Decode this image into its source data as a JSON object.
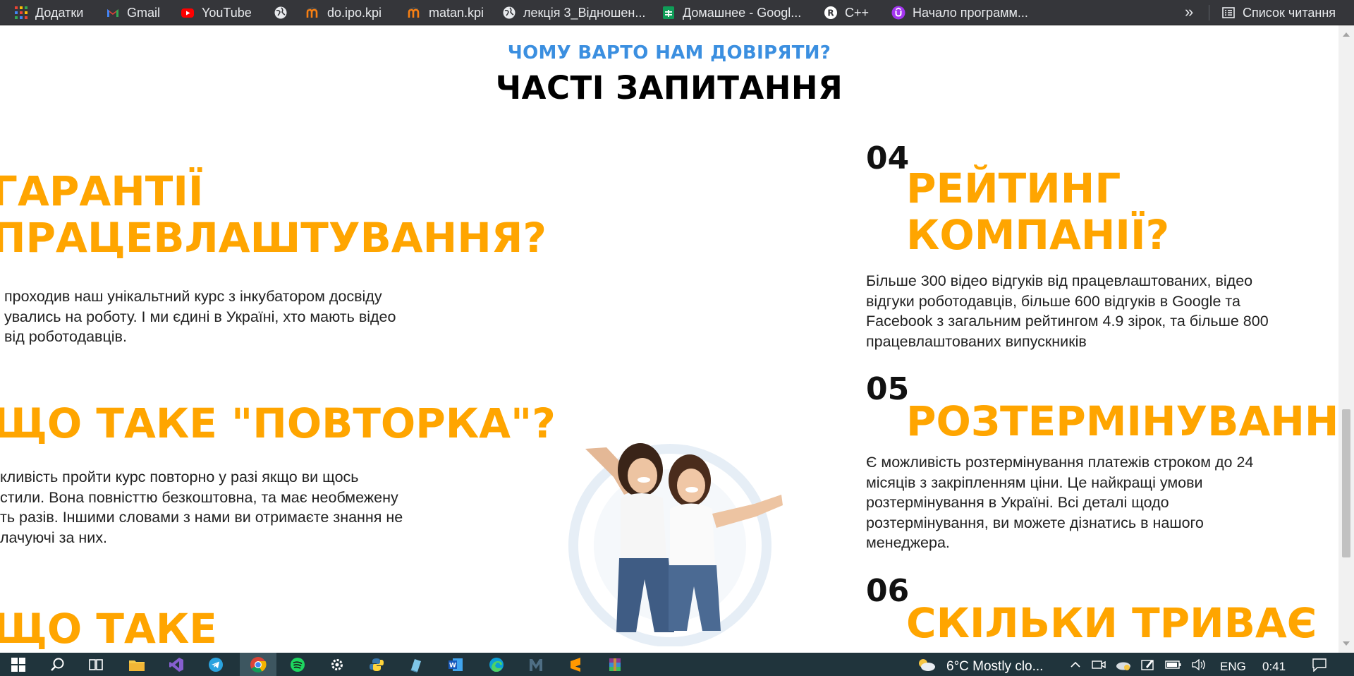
{
  "bookmarks": {
    "items": [
      {
        "label": "Додатки",
        "icon": "apps-grid-icon"
      },
      {
        "label": "Gmail",
        "icon": "gmail-icon"
      },
      {
        "label": "YouTube",
        "icon": "youtube-icon"
      },
      {
        "label": "",
        "icon": "globe-icon"
      },
      {
        "label": "do.ipo.kpi",
        "icon": "moodle-icon"
      },
      {
        "label": "matan.kpi",
        "icon": "moodle-icon"
      },
      {
        "label": "лекція 3_Відношен...",
        "icon": "globe-icon"
      },
      {
        "label": "Домашнее - Googl...",
        "icon": "google-sheets-icon"
      },
      {
        "label": "C++",
        "icon": "replit-icon"
      },
      {
        "label": "Начало программ...",
        "icon": "udemy-icon"
      }
    ],
    "overflow": "»",
    "reading_list": "Список читання"
  },
  "section": {
    "subtitle": "ЧОМУ ВАРТО НАМ ДОВІРЯТИ?",
    "title": "ЧАСТІ ЗАПИТАННЯ"
  },
  "faq_left": [
    {
      "title_lines": [
        "ГАРАНТІЇ",
        "ПРАЦЕВЛАШТУВАННЯ?"
      ],
      "text_lines": [
        "проходив наш унікальтний курс з інкубатором досвіду",
        "увались на роботу. І ми єдині в Україні, хто мають відео",
        "від роботодавців."
      ]
    },
    {
      "title_lines": [
        "ЩО ТАКЕ \"ПОВТОРКА\"?"
      ],
      "text_lines": [
        "кливість пройти курс повторно у разі якщо ви щось",
        "стили. Вона повністтю безкоштовна, та має необмежену",
        "ть разів. Іншими словами з нами ви отримаєте знання не",
        "лачуючі за них."
      ]
    },
    {
      "title_lines": [
        "ЩО ТАКЕ"
      ],
      "text_lines": []
    }
  ],
  "faq_right": [
    {
      "number": "04",
      "title_lines": [
        "РЕЙТИНГ",
        "КОМПАНІЇ?"
      ],
      "text_lines": [
        "Більше 300 відео відгуків від працевлаштованих, відео",
        "відгуки роботодавців, більше 600 відгуків в Google та",
        "Facebook з загальним рейтингом 4.9 зірок, та більше 800",
        "працевлаштованих випускників"
      ]
    },
    {
      "number": "05",
      "title_lines": [
        "РОЗТЕРМІНУВАННЯ?"
      ],
      "text_lines": [
        "Є можливість розтермінування платежів строком до 24",
        "місяців з закріпленням ціни. Це найкращі умови",
        "розтермінування в Україні. Всі деталі щодо",
        "розтермінування, ви можете дізнатись в нашого",
        "менеджера."
      ]
    },
    {
      "number": "06",
      "title_lines": [
        "СКІЛЬКИ ТРИВАЄ"
      ],
      "text_lines": []
    }
  ],
  "illustration": {
    "icon": "two-smiling-women-image"
  },
  "taskbar": {
    "apps": [
      {
        "icon": "windows-start-icon"
      },
      {
        "icon": "search-icon"
      },
      {
        "icon": "task-view-icon"
      },
      {
        "icon": "file-explorer-icon"
      },
      {
        "icon": "visual-studio-icon"
      },
      {
        "icon": "telegram-icon"
      },
      {
        "icon": "chrome-icon",
        "active": true
      },
      {
        "icon": "spotify-icon"
      },
      {
        "icon": "settings-gear-icon"
      },
      {
        "icon": "python-icon"
      },
      {
        "icon": "notepad-icon"
      },
      {
        "icon": "word-icon"
      },
      {
        "icon": "edge-icon"
      },
      {
        "icon": "m-app-icon"
      },
      {
        "icon": "sublime-icon"
      },
      {
        "icon": "winrar-icon"
      }
    ],
    "weather": "6°C  Mostly clo...",
    "language": "ENG",
    "time": "0:41",
    "colors": {
      "background": "#20343c",
      "active": "#3d5660"
    }
  },
  "colors": {
    "accent_orange": "#ffa500",
    "accent_blue": "#3b8fe0",
    "bookmarks_bg": "#35363a"
  }
}
